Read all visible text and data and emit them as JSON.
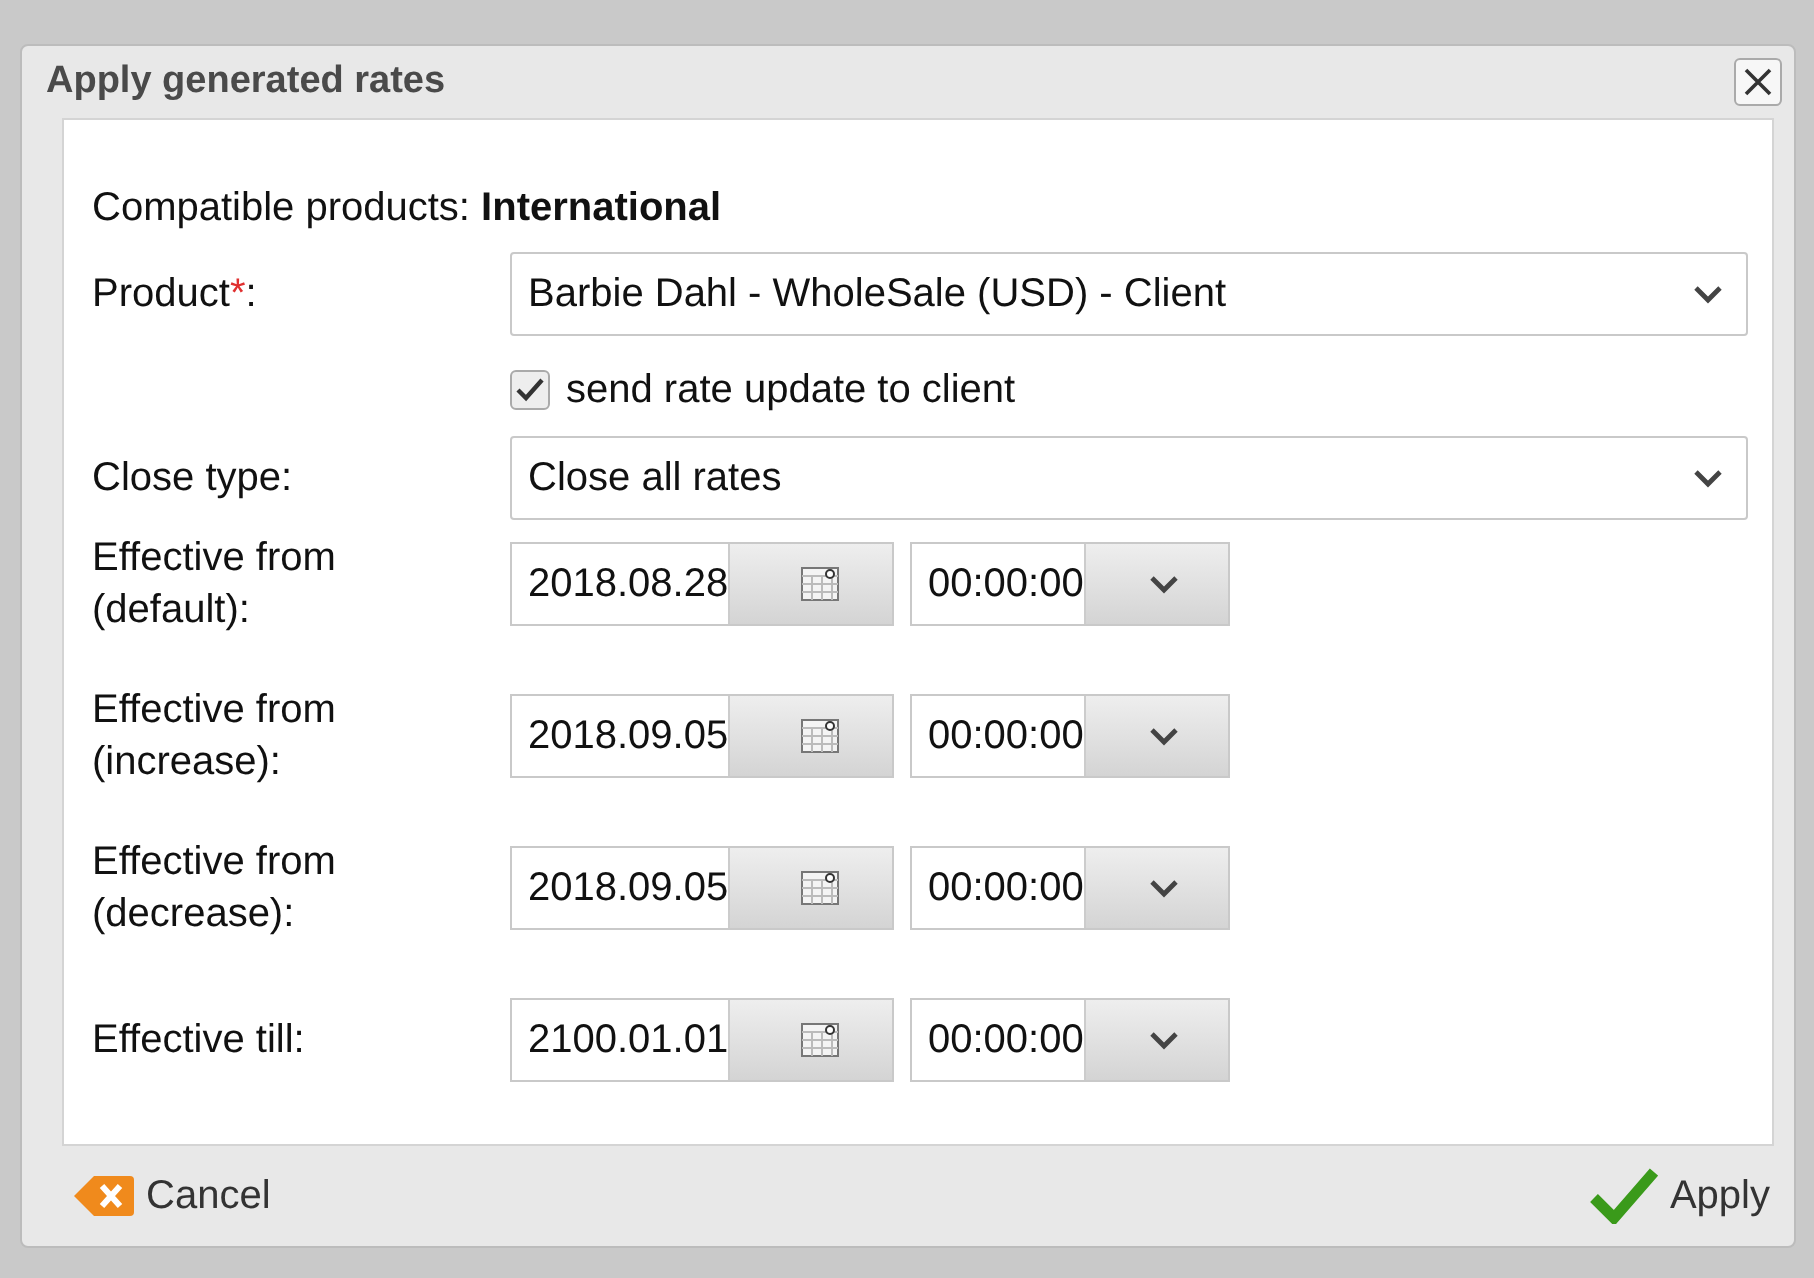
{
  "window": {
    "title": "Apply generated rates"
  },
  "compatible": {
    "label": "Compatible products:",
    "value": "International"
  },
  "product": {
    "label": "Product",
    "required_mark": "*",
    "suffix": ":",
    "value": "Barbie Dahl - WholeSale (USD) - Client"
  },
  "send_update": {
    "label": "send rate update to client",
    "checked": true
  },
  "close_type": {
    "label": "Close type:",
    "value": "Close all rates"
  },
  "dates": [
    {
      "label": "Effective from (default):",
      "date": "2018.08.28",
      "time": "00:00:00"
    },
    {
      "label": "Effective from (increase):",
      "date": "2018.09.05",
      "time": "00:00:00"
    },
    {
      "label": "Effective from (decrease):",
      "date": "2018.09.05",
      "time": "00:00:00"
    },
    {
      "label": "Effective till:",
      "date": "2100.01.01",
      "time": "00:00:00"
    }
  ],
  "buttons": [
    {
      "kind": "cancel",
      "label": "Cancel"
    },
    {
      "kind": "apply",
      "label": "Apply"
    }
  ]
}
